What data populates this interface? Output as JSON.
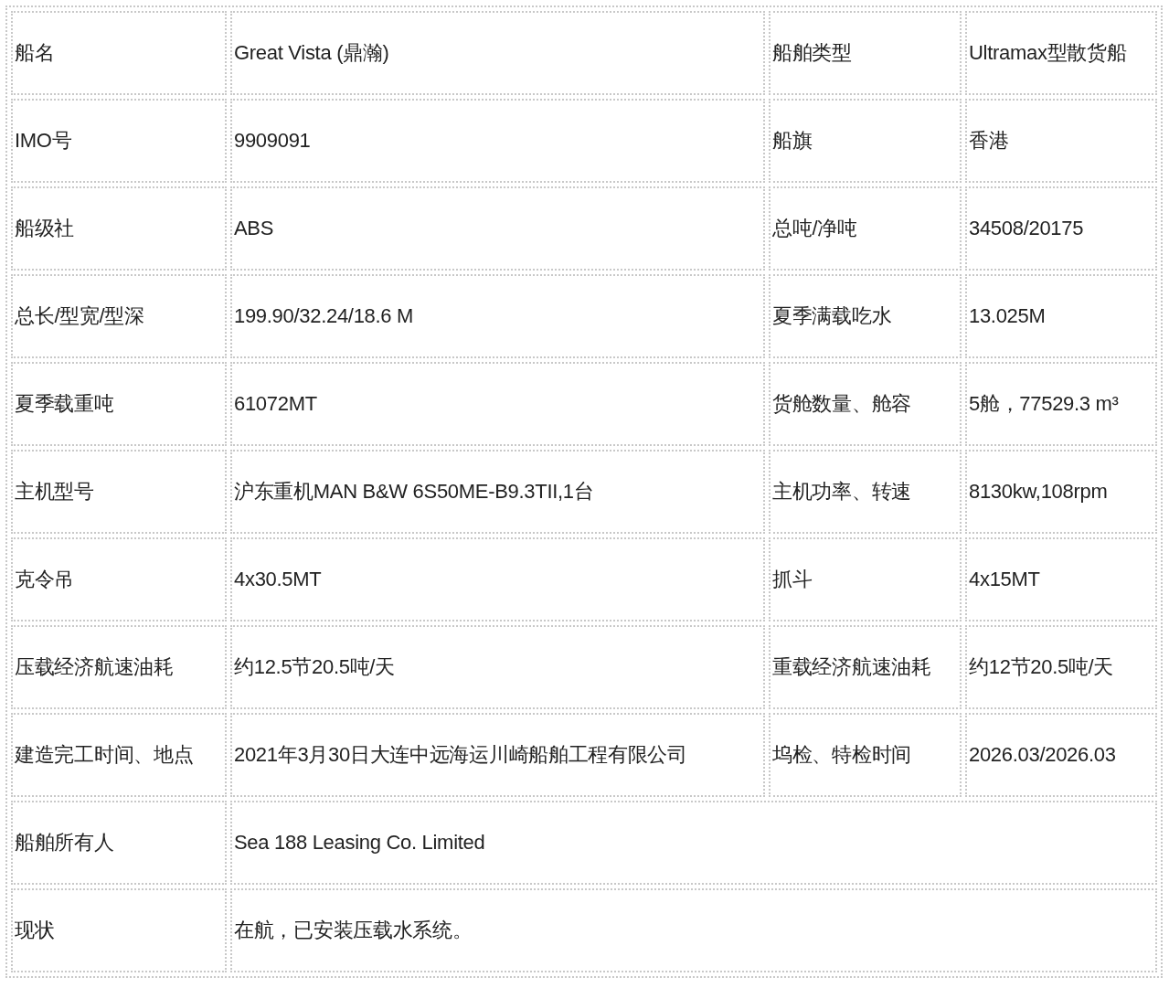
{
  "table": {
    "rows": [
      {
        "cells": [
          {
            "text": "船名"
          },
          {
            "text": "Great Vista (鼎瀚)"
          },
          {
            "text": "船舶类型"
          },
          {
            "text": "Ultramax型散货船"
          }
        ]
      },
      {
        "cells": [
          {
            "text": "IMO号"
          },
          {
            "text": "9909091"
          },
          {
            "text": "船旗"
          },
          {
            "text": "香港"
          }
        ]
      },
      {
        "cells": [
          {
            "text": "船级社"
          },
          {
            "text": "ABS"
          },
          {
            "text": "总吨/净吨"
          },
          {
            "text": "34508/20175"
          }
        ]
      },
      {
        "cells": [
          {
            "text": "总长/型宽/型深"
          },
          {
            "text": "199.90/32.24/18.6 M"
          },
          {
            "text": "夏季满载吃水"
          },
          {
            "text": "13.025M"
          }
        ]
      },
      {
        "cells": [
          {
            "text": "夏季载重吨"
          },
          {
            "text": "61072MT"
          },
          {
            "text": "货舱数量、舱容"
          },
          {
            "text": "5舱，77529.3 m³"
          }
        ]
      },
      {
        "cells": [
          {
            "text": "主机型号"
          },
          {
            "text": "沪东重机MAN B&W 6S50ME-B9.3TII,1台"
          },
          {
            "text": "主机功率、转速"
          },
          {
            "text": "8130kw,108rpm"
          }
        ]
      },
      {
        "cells": [
          {
            "text": "克令吊"
          },
          {
            "text": "4x30.5MT"
          },
          {
            "text": "抓斗"
          },
          {
            "text": "4x15MT"
          }
        ]
      },
      {
        "cells": [
          {
            "text": "压载经济航速油耗"
          },
          {
            "text": "约12.5节20.5吨/天"
          },
          {
            "text": "重载经济航速油耗"
          },
          {
            "text": "约12节20.5吨/天"
          }
        ]
      },
      {
        "cells": [
          {
            "text": "建造完工时间、地点"
          },
          {
            "text": "2021年3月30日大连中远海运川崎船舶工程有限公司"
          },
          {
            "text": "坞检、特检时间"
          },
          {
            "text": "2026.03/2026.03"
          }
        ]
      },
      {
        "cells": [
          {
            "text": "船舶所有人"
          },
          {
            "text": "Sea 188 Leasing Co. Limited",
            "colspan": 3
          }
        ]
      },
      {
        "cells": [
          {
            "text": "现状"
          },
          {
            "text": "在航，已安装压载水系统。",
            "colspan": 3
          }
        ]
      }
    ]
  }
}
